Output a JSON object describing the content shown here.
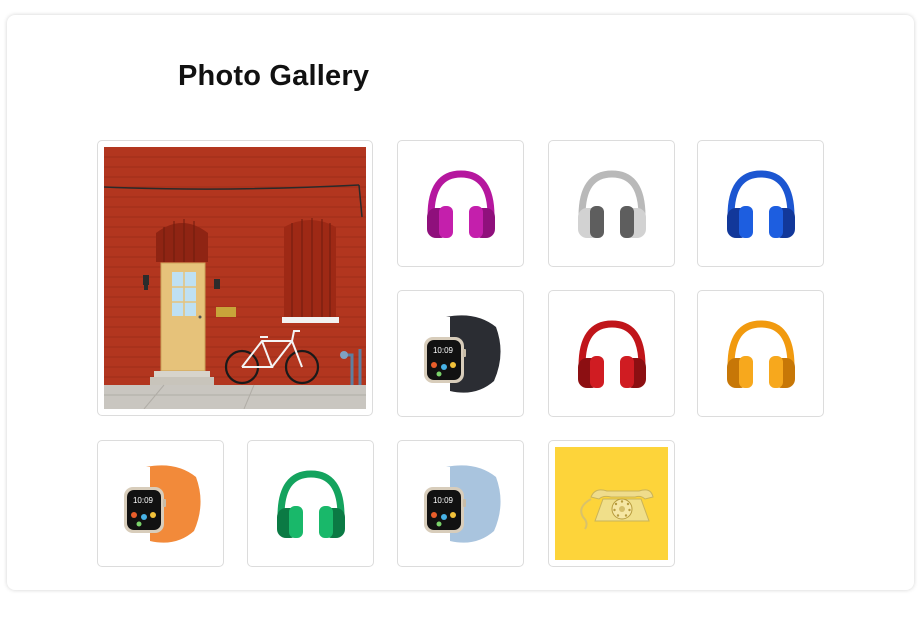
{
  "gallery": {
    "title": "Photo Gallery",
    "images": [
      {
        "name": "red-brick-door-bicycle",
        "featured": true
      },
      {
        "name": "headphones-magenta",
        "color": "#b5179e"
      },
      {
        "name": "headphones-gray",
        "color": "#8a8a8a"
      },
      {
        "name": "headphones-blue",
        "color": "#1746b8"
      },
      {
        "name": "watch-midnight",
        "band": "#2b2d33",
        "screen_time": "10:09"
      },
      {
        "name": "headphones-red",
        "color": "#c0151a"
      },
      {
        "name": "headphones-orange",
        "color": "#f19a0f"
      },
      {
        "name": "watch-orange",
        "band": "#f28a3a",
        "screen_time": "10:09"
      },
      {
        "name": "headphones-green",
        "color": "#14a35e"
      },
      {
        "name": "watch-lightblue",
        "band": "#a9c4de",
        "screen_time": "10:09"
      },
      {
        "name": "yellow-rotary-phone",
        "background": "#fdd43a"
      }
    ]
  },
  "colors": {
    "brick": "#b2361f",
    "door": "#e6c27a",
    "sky_window": "#bfe0f2",
    "phone_bg": "#fdd43a"
  }
}
